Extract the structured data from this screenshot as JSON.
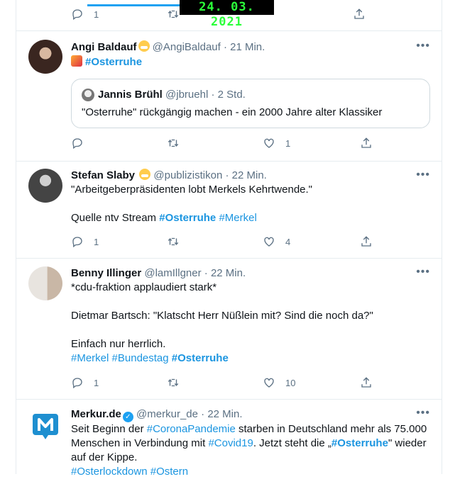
{
  "date_stamp": "24. 03. 2021",
  "top_bar": {
    "reply_count": "1"
  },
  "tweets": [
    {
      "name": "Angi Baldauf",
      "handle": "@AngiBaldauf",
      "time": "· 21 Min.",
      "body": [
        "#Osterruhe"
      ],
      "quote": {
        "name": "Jannis Brühl",
        "handle": "@jbruehl",
        "time": "· 2 Std.",
        "text": "\"Osterruhe\" rückgängig machen - ein 2000 Jahre alter Klassiker"
      },
      "reply_count": "",
      "like_count": "1"
    },
    {
      "name": "Stefan Slaby",
      "handle": "@publizistikon",
      "time": "· 22 Min.",
      "line1": "\"Arbeitgeberpräsidenten lobt Merkels Kehrtwende.\"",
      "line2_prefix": "Quelle ntv Stream",
      "tag1": "#Osterruhe",
      "tag2": "#Merkel",
      "reply_count": "1",
      "like_count": "4"
    },
    {
      "name": "Benny Illinger",
      "handle": "@lamIllgner",
      "time": "· 22 Min.",
      "line1": "*cdu-fraktion applaudiert stark*",
      "line2": "Dietmar Bartsch: \"Klatscht Herr Nüßlein mit? Sind die noch da?\"",
      "line3": "Einfach nur herrlich.",
      "tag1": "#Merkel",
      "tag2": "#Bundestag",
      "tag3": "#Osterruhe",
      "reply_count": "1",
      "like_count": "10"
    },
    {
      "name": "Merkur.de",
      "handle": "@merkur_de",
      "time": "· 22 Min.",
      "p1_a": "Seit Beginn der",
      "p1_tag": "#CoronaPandemie",
      "p1_b": "starben in Deutschland mehr als 75.000",
      "p2_a": "Menschen in Verbindung mit",
      "p2_tag": "#Covid19",
      "p2_b": ". Jetzt steht die „",
      "p2_tag2": "#Osterruhe",
      "p2_c": "\" wieder",
      "p3": "auf der Kippe.",
      "p4_tag1": "#Osterlockdown",
      "p4_tag2": "#Ostern"
    }
  ]
}
